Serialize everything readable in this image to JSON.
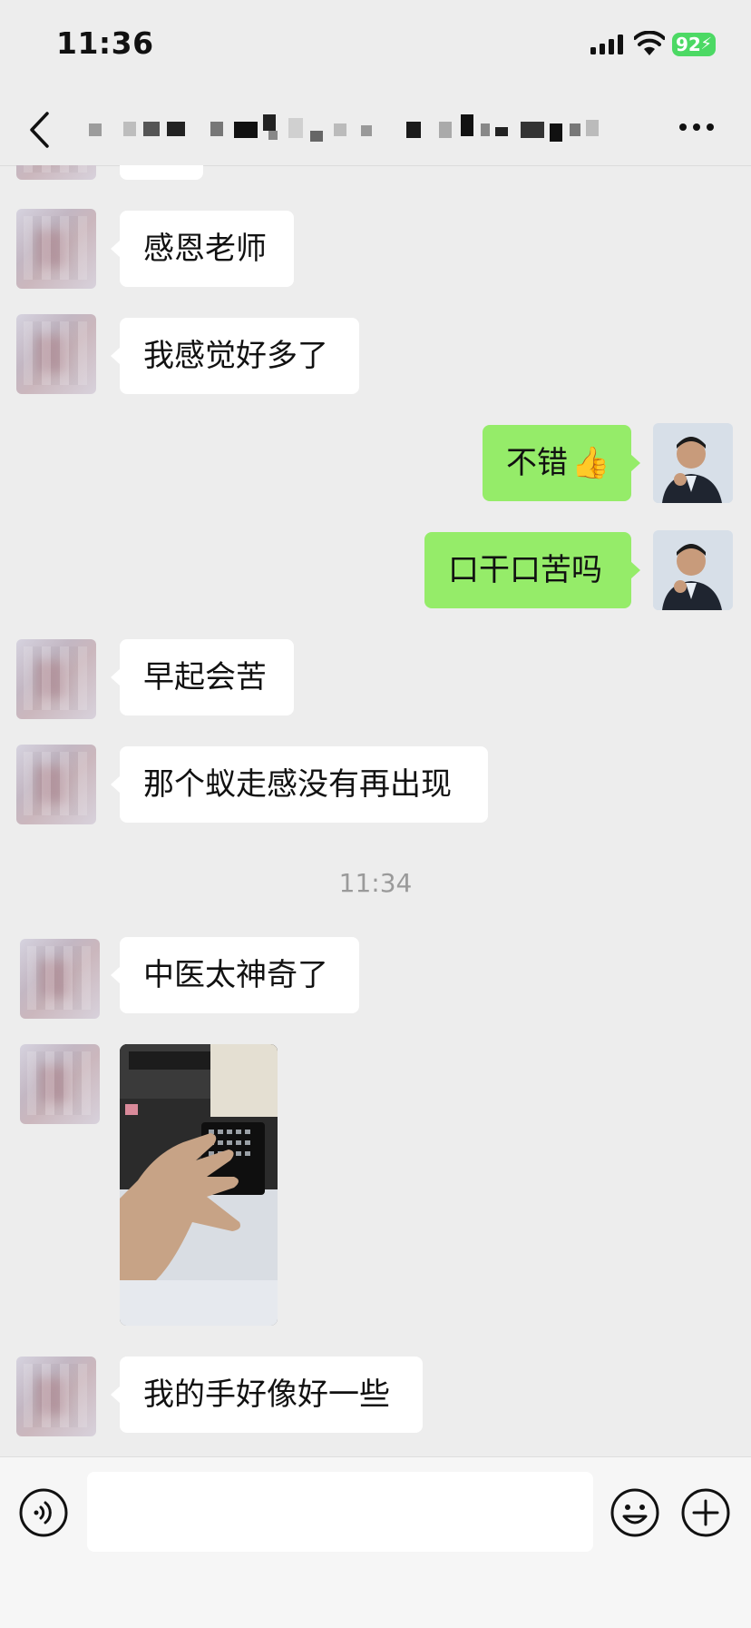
{
  "status_bar": {
    "time": "11:36",
    "battery": "92"
  },
  "nav": {
    "title_redacted": true
  },
  "messages": [
    {
      "side": "left",
      "text": "感恩老师"
    },
    {
      "side": "left",
      "text": "我感觉好多了"
    },
    {
      "side": "right",
      "text": "不错",
      "emoji": "👍"
    },
    {
      "side": "right",
      "text": "口干口苦吗"
    },
    {
      "side": "left",
      "text": "早起会苦"
    },
    {
      "side": "left",
      "text": "那个蚁走感没有再出现"
    },
    {
      "side": "left",
      "text": "中医太神奇了"
    },
    {
      "side": "left",
      "type": "image"
    },
    {
      "side": "left",
      "text": "我的手好像好一些"
    }
  ],
  "timestamp": "11:34",
  "colors": {
    "background": "#ededed",
    "left_bubble": "#ffffff",
    "right_bubble": "#95ec69",
    "battery": "#4cd964"
  }
}
